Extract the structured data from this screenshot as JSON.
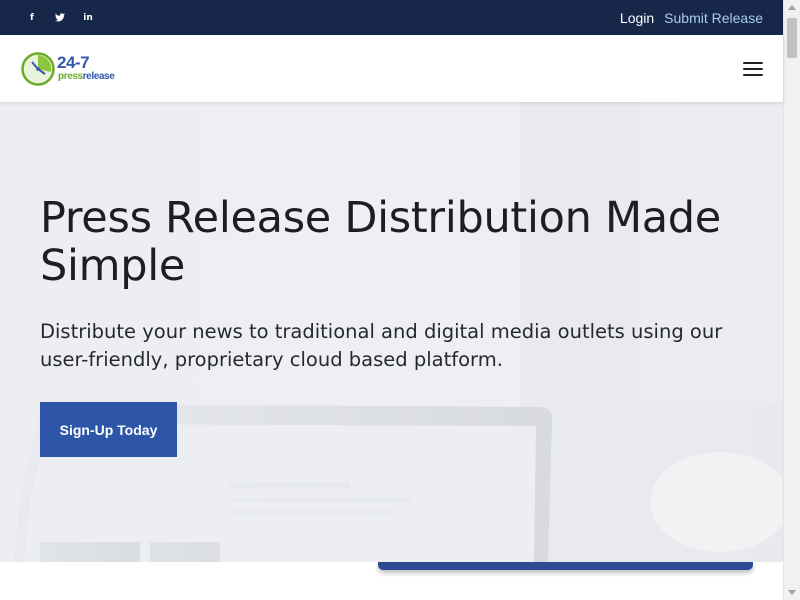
{
  "topbar": {
    "social": [
      {
        "icon": "facebook-icon",
        "glyph": "f"
      },
      {
        "icon": "twitter-icon",
        "glyph": "🐦"
      },
      {
        "icon": "linkedin-icon",
        "glyph": "in"
      }
    ],
    "login_label": "Login",
    "submit_label": "Submit Release"
  },
  "header": {
    "logo": {
      "line1": "24-7",
      "line2_part1": "press",
      "line2_part2": "release"
    },
    "menu_icon": "hamburger-menu-icon"
  },
  "hero": {
    "title": "Press Release Distribution Made Simple",
    "subtitle": "Distribute your news to traditional and digital media outlets using our user-friendly, proprietary cloud based platform.",
    "cta_label": "Sign-Up Today"
  },
  "colors": {
    "topbar": "#16274a",
    "accent": "#2d55a8",
    "submit_link": "#a9ccf2",
    "logo_blue": "#3558a8",
    "logo_green": "#6cab29"
  }
}
